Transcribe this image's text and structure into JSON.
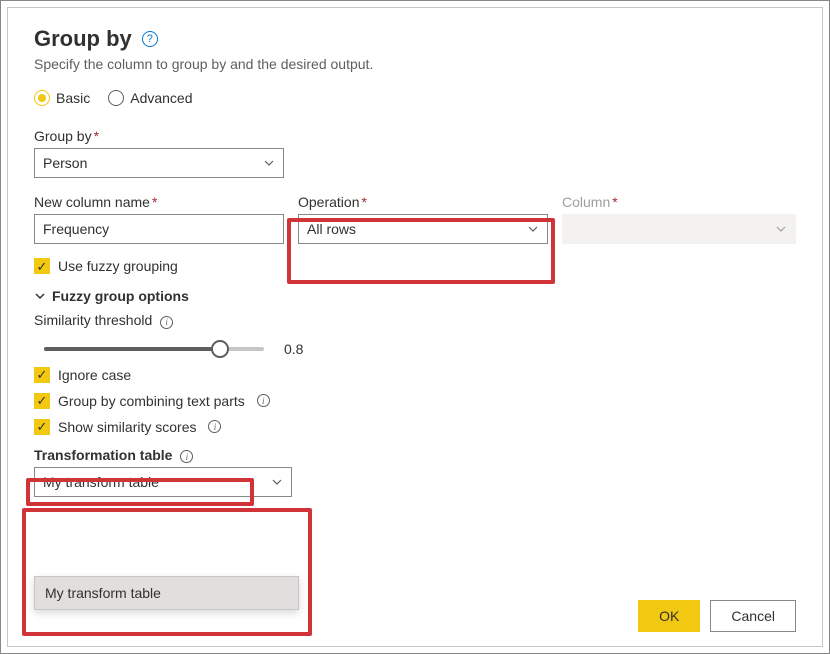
{
  "title": "Group by",
  "subtitle": "Specify the column to group by and the desired output.",
  "mode": {
    "basic": "Basic",
    "advanced": "Advanced",
    "selected": "basic"
  },
  "groupby": {
    "label": "Group by",
    "value": "Person"
  },
  "newcol": {
    "label": "New column name",
    "value": "Frequency"
  },
  "operation": {
    "label": "Operation",
    "value": "All rows"
  },
  "column": {
    "label": "Column",
    "value": ""
  },
  "fuzzy": {
    "use_label": "Use fuzzy grouping",
    "section": "Fuzzy group options",
    "threshold_label": "Similarity threshold",
    "threshold_value": "0.8",
    "ignore_case": "Ignore case",
    "combine_parts": "Group by combining text parts",
    "show_scores": "Show similarity scores",
    "trans_label": "Transformation table",
    "trans_value": "My transform table",
    "dd_option": "My transform table"
  },
  "buttons": {
    "ok": "OK",
    "cancel": "Cancel"
  }
}
